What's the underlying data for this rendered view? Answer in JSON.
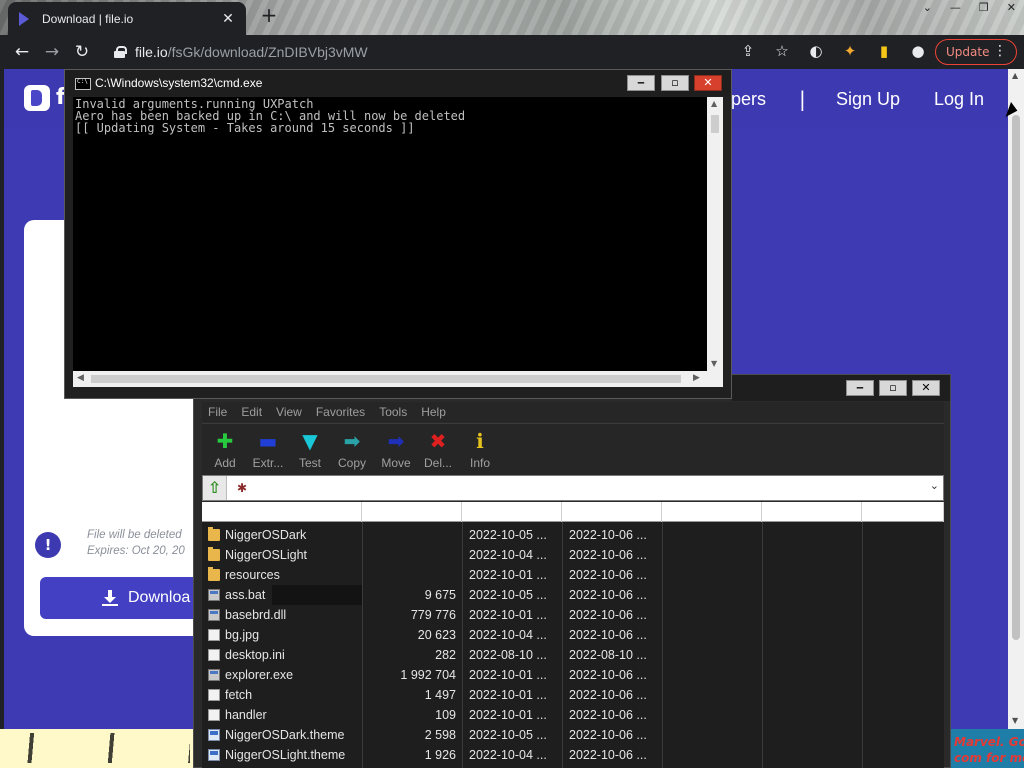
{
  "browser": {
    "tab_title": "Download | file.io",
    "tab_close": "✕",
    "new_tab": "+",
    "url_host": "file.io",
    "url_path": "/fsGk/download/ZnDIBVbj3vMW",
    "update_label": "Update",
    "window_controls": [
      "⌄",
      "—",
      "❐",
      "✕"
    ]
  },
  "site": {
    "brand": "f",
    "nav_partial": "pers",
    "nav_sep": "|",
    "nav_signup": "Sign Up",
    "nav_login": "Log In",
    "info_line1": "File will be deleted",
    "info_line2": "Expires: Oct 20, 20",
    "download_label": "Downloa"
  },
  "cmd": {
    "title": "C:\\Windows\\system32\\cmd.exe",
    "lines": [
      "Invalid arguments.running UXPatch",
      "Aero has been backed up in C:\\ and will now be deleted",
      "[[ Updating System - Takes around 15 seconds ]]"
    ]
  },
  "zip": {
    "menu": [
      "File",
      "Edit",
      "View",
      "Favorites",
      "Tools",
      "Help"
    ],
    "tools": [
      {
        "label": "Add",
        "icon": "plus-icon",
        "glyph": "✚",
        "color": "#27c93f"
      },
      {
        "label": "Extr...",
        "icon": "extract-icon",
        "glyph": "▬",
        "color": "#1f3fd6"
      },
      {
        "label": "Test",
        "icon": "test-icon",
        "glyph": "▼",
        "color": "#19c7d6"
      },
      {
        "label": "Copy",
        "icon": "copy-icon",
        "glyph": "➡",
        "color": "#2aa3a8"
      },
      {
        "label": "Move",
        "icon": "move-icon",
        "glyph": "➡",
        "color": "#1e2fb8"
      },
      {
        "label": "Del...",
        "icon": "delete-icon",
        "glyph": "✖",
        "color": "#e02020"
      },
      {
        "label": "Info",
        "icon": "info-icon",
        "glyph": "ℹ",
        "color": "#e6c21c"
      }
    ],
    "files": [
      {
        "name": "NiggerOSDark",
        "type": "folder",
        "size": "",
        "modified": "2022-10-05 ...",
        "created": "2022-10-06 ..."
      },
      {
        "name": "NiggerOSLight",
        "type": "folder",
        "size": "",
        "modified": "2022-10-04 ...",
        "created": "2022-10-06 ..."
      },
      {
        "name": "resources",
        "type": "folder",
        "size": "",
        "modified": "2022-10-01 ...",
        "created": "2022-10-06 ..."
      },
      {
        "name": "ass.bat",
        "type": "app",
        "size": "9 675",
        "modified": "2022-10-05 ...",
        "created": "2022-10-06 ..."
      },
      {
        "name": "basebrd.dll",
        "type": "app",
        "size": "779 776",
        "modified": "2022-10-01 ...",
        "created": "2022-10-06 ..."
      },
      {
        "name": "bg.jpg",
        "type": "doc",
        "size": "20 623",
        "modified": "2022-10-04 ...",
        "created": "2022-10-06 ..."
      },
      {
        "name": "desktop.ini",
        "type": "doc",
        "size": "282",
        "modified": "2022-08-10 ...",
        "created": "2022-08-10 ..."
      },
      {
        "name": "explorer.exe",
        "type": "app",
        "size": "1 992 704",
        "modified": "2022-10-01 ...",
        "created": "2022-10-06 ..."
      },
      {
        "name": "fetch",
        "type": "doc",
        "size": "1 497",
        "modified": "2022-10-01 ...",
        "created": "2022-10-06 ..."
      },
      {
        "name": "handler",
        "type": "doc",
        "size": "109",
        "modified": "2022-10-01 ...",
        "created": "2022-10-06 ..."
      },
      {
        "name": "NiggerOSDark.theme",
        "type": "theme",
        "size": "2 598",
        "modified": "2022-10-05 ...",
        "created": "2022-10-06 ..."
      },
      {
        "name": "NiggerOSLight.theme",
        "type": "theme",
        "size": "1 926",
        "modified": "2022-10-04 ...",
        "created": "2022-10-06 ..."
      }
    ]
  },
  "desktop": {
    "right_text1": "Marvel. Go",
    "right_text2": "com for mo"
  }
}
